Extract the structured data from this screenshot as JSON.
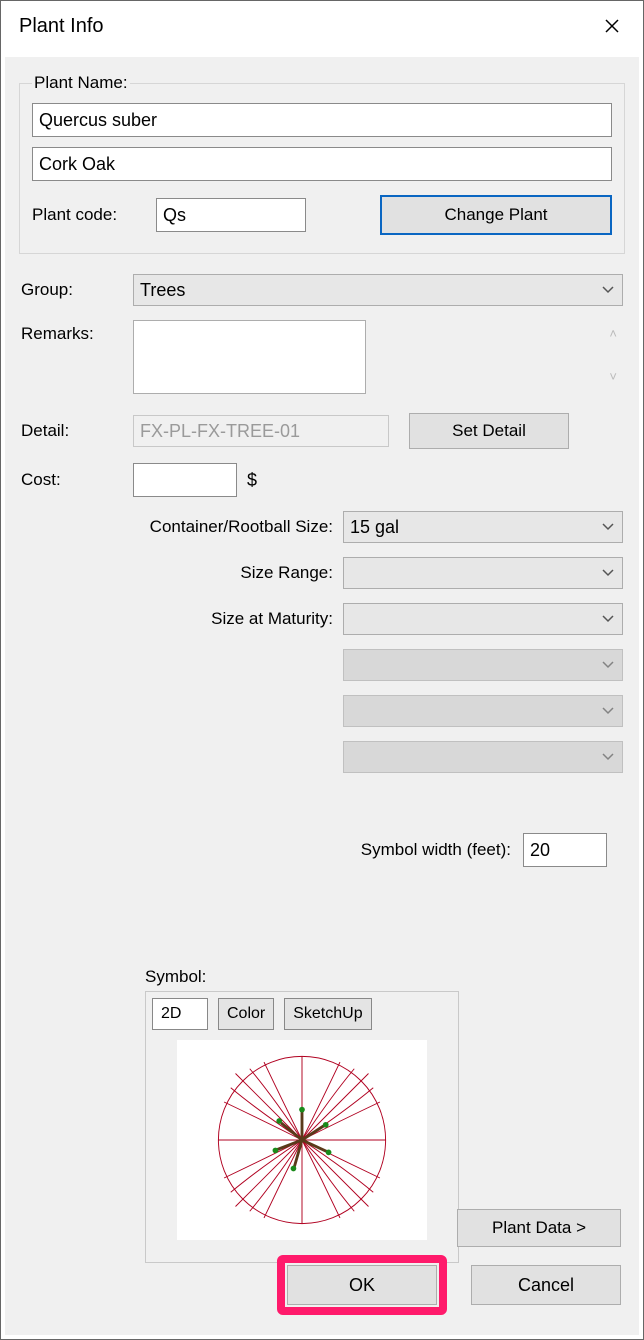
{
  "window": {
    "title": "Plant Info"
  },
  "plant_name": {
    "legend": "Plant Name:",
    "latin": "Quercus suber",
    "common": "Cork Oak",
    "code_label": "Plant code:",
    "code": "Qs",
    "change_button": "Change Plant"
  },
  "group": {
    "label": "Group:",
    "value": "Trees"
  },
  "remarks": {
    "label": "Remarks:",
    "value": ""
  },
  "detail": {
    "label": "Detail:",
    "value": "FX-PL-FX-TREE-01",
    "set_button": "Set Detail"
  },
  "cost": {
    "label": "Cost:",
    "value": "",
    "currency": "$"
  },
  "sizes": {
    "container_label": "Container/Rootball Size:",
    "container_value": "15 gal",
    "range_label": "Size Range:",
    "range_value": "",
    "maturity_label": "Size at Maturity:",
    "maturity_value": "",
    "extra1": "",
    "extra2": "",
    "extra3": ""
  },
  "symbol_width": {
    "label": "Symbol width (feet):",
    "value": "20"
  },
  "symbol": {
    "label": "Symbol:",
    "mode": "2D",
    "color_btn": "Color",
    "sketchup_btn": "SketchUp"
  },
  "buttons": {
    "plant_data": "Plant Data >",
    "ok": "OK",
    "cancel": "Cancel"
  }
}
